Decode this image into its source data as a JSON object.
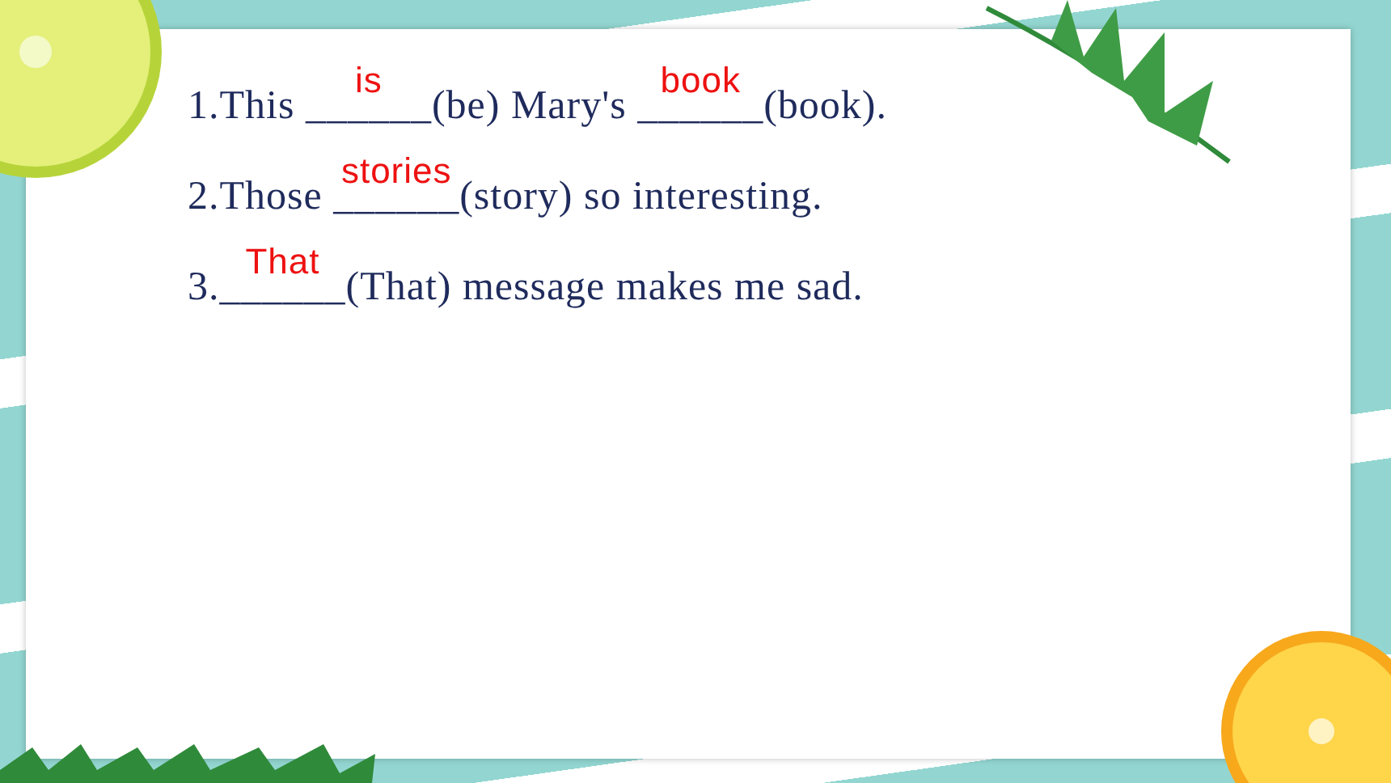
{
  "exercises": [
    {
      "number": "1.",
      "segments": [
        {
          "kind": "text",
          "text": "This "
        },
        {
          "kind": "blank",
          "blank": "______",
          "answer": "is"
        },
        {
          "kind": "text",
          "text": "(be) Mary's "
        },
        {
          "kind": "blank",
          "blank": "______",
          "answer": "book"
        },
        {
          "kind": "text",
          "text": "(book)."
        }
      ]
    },
    {
      "number": "2.",
      "segments": [
        {
          "kind": "text",
          "text": "Those "
        },
        {
          "kind": "blank",
          "blank": "______",
          "answer": "stories"
        },
        {
          "kind": "text",
          "text": "(story) so interesting."
        }
      ]
    },
    {
      "number": "3.",
      "segments": [
        {
          "kind": "blank",
          "blank": "______",
          "answer": "That"
        },
        {
          "kind": "text",
          "text": "(That) message makes me sad."
        }
      ]
    }
  ]
}
